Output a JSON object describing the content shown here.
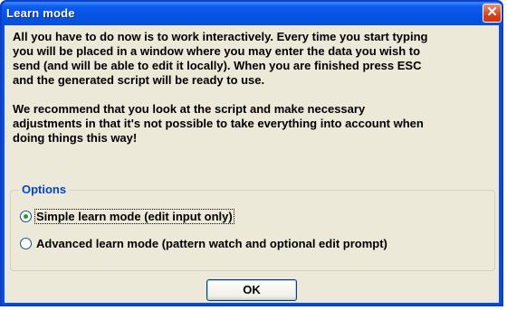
{
  "window": {
    "title": "Learn mode",
    "close_glyph": "✕"
  },
  "message": {
    "paragraph1": "All you have to do now is to work interactively. Every time you start typing\nyou will be placed in a window where you may enter the data you wish to\nsend (and will be able to edit it locally). When you are finished press ESC\nand the generated script will be ready to use.",
    "paragraph2": "We recommend that you look at the script and make necessary\nadjustments in that it's not possible to take everything into account when\ndoing things this way!"
  },
  "options": {
    "label": "Options",
    "items": [
      {
        "label": "Simple learn mode (edit input only)",
        "checked": true
      },
      {
        "label": "Advanced learn mode (pattern watch and optional edit prompt)",
        "checked": false
      }
    ]
  },
  "buttons": {
    "ok_label": "OK"
  },
  "colors": {
    "titlebar": "#0553e2",
    "client_bg": "#ece9d8",
    "group_label": "#0046d5",
    "close_button": "#d8411b"
  }
}
